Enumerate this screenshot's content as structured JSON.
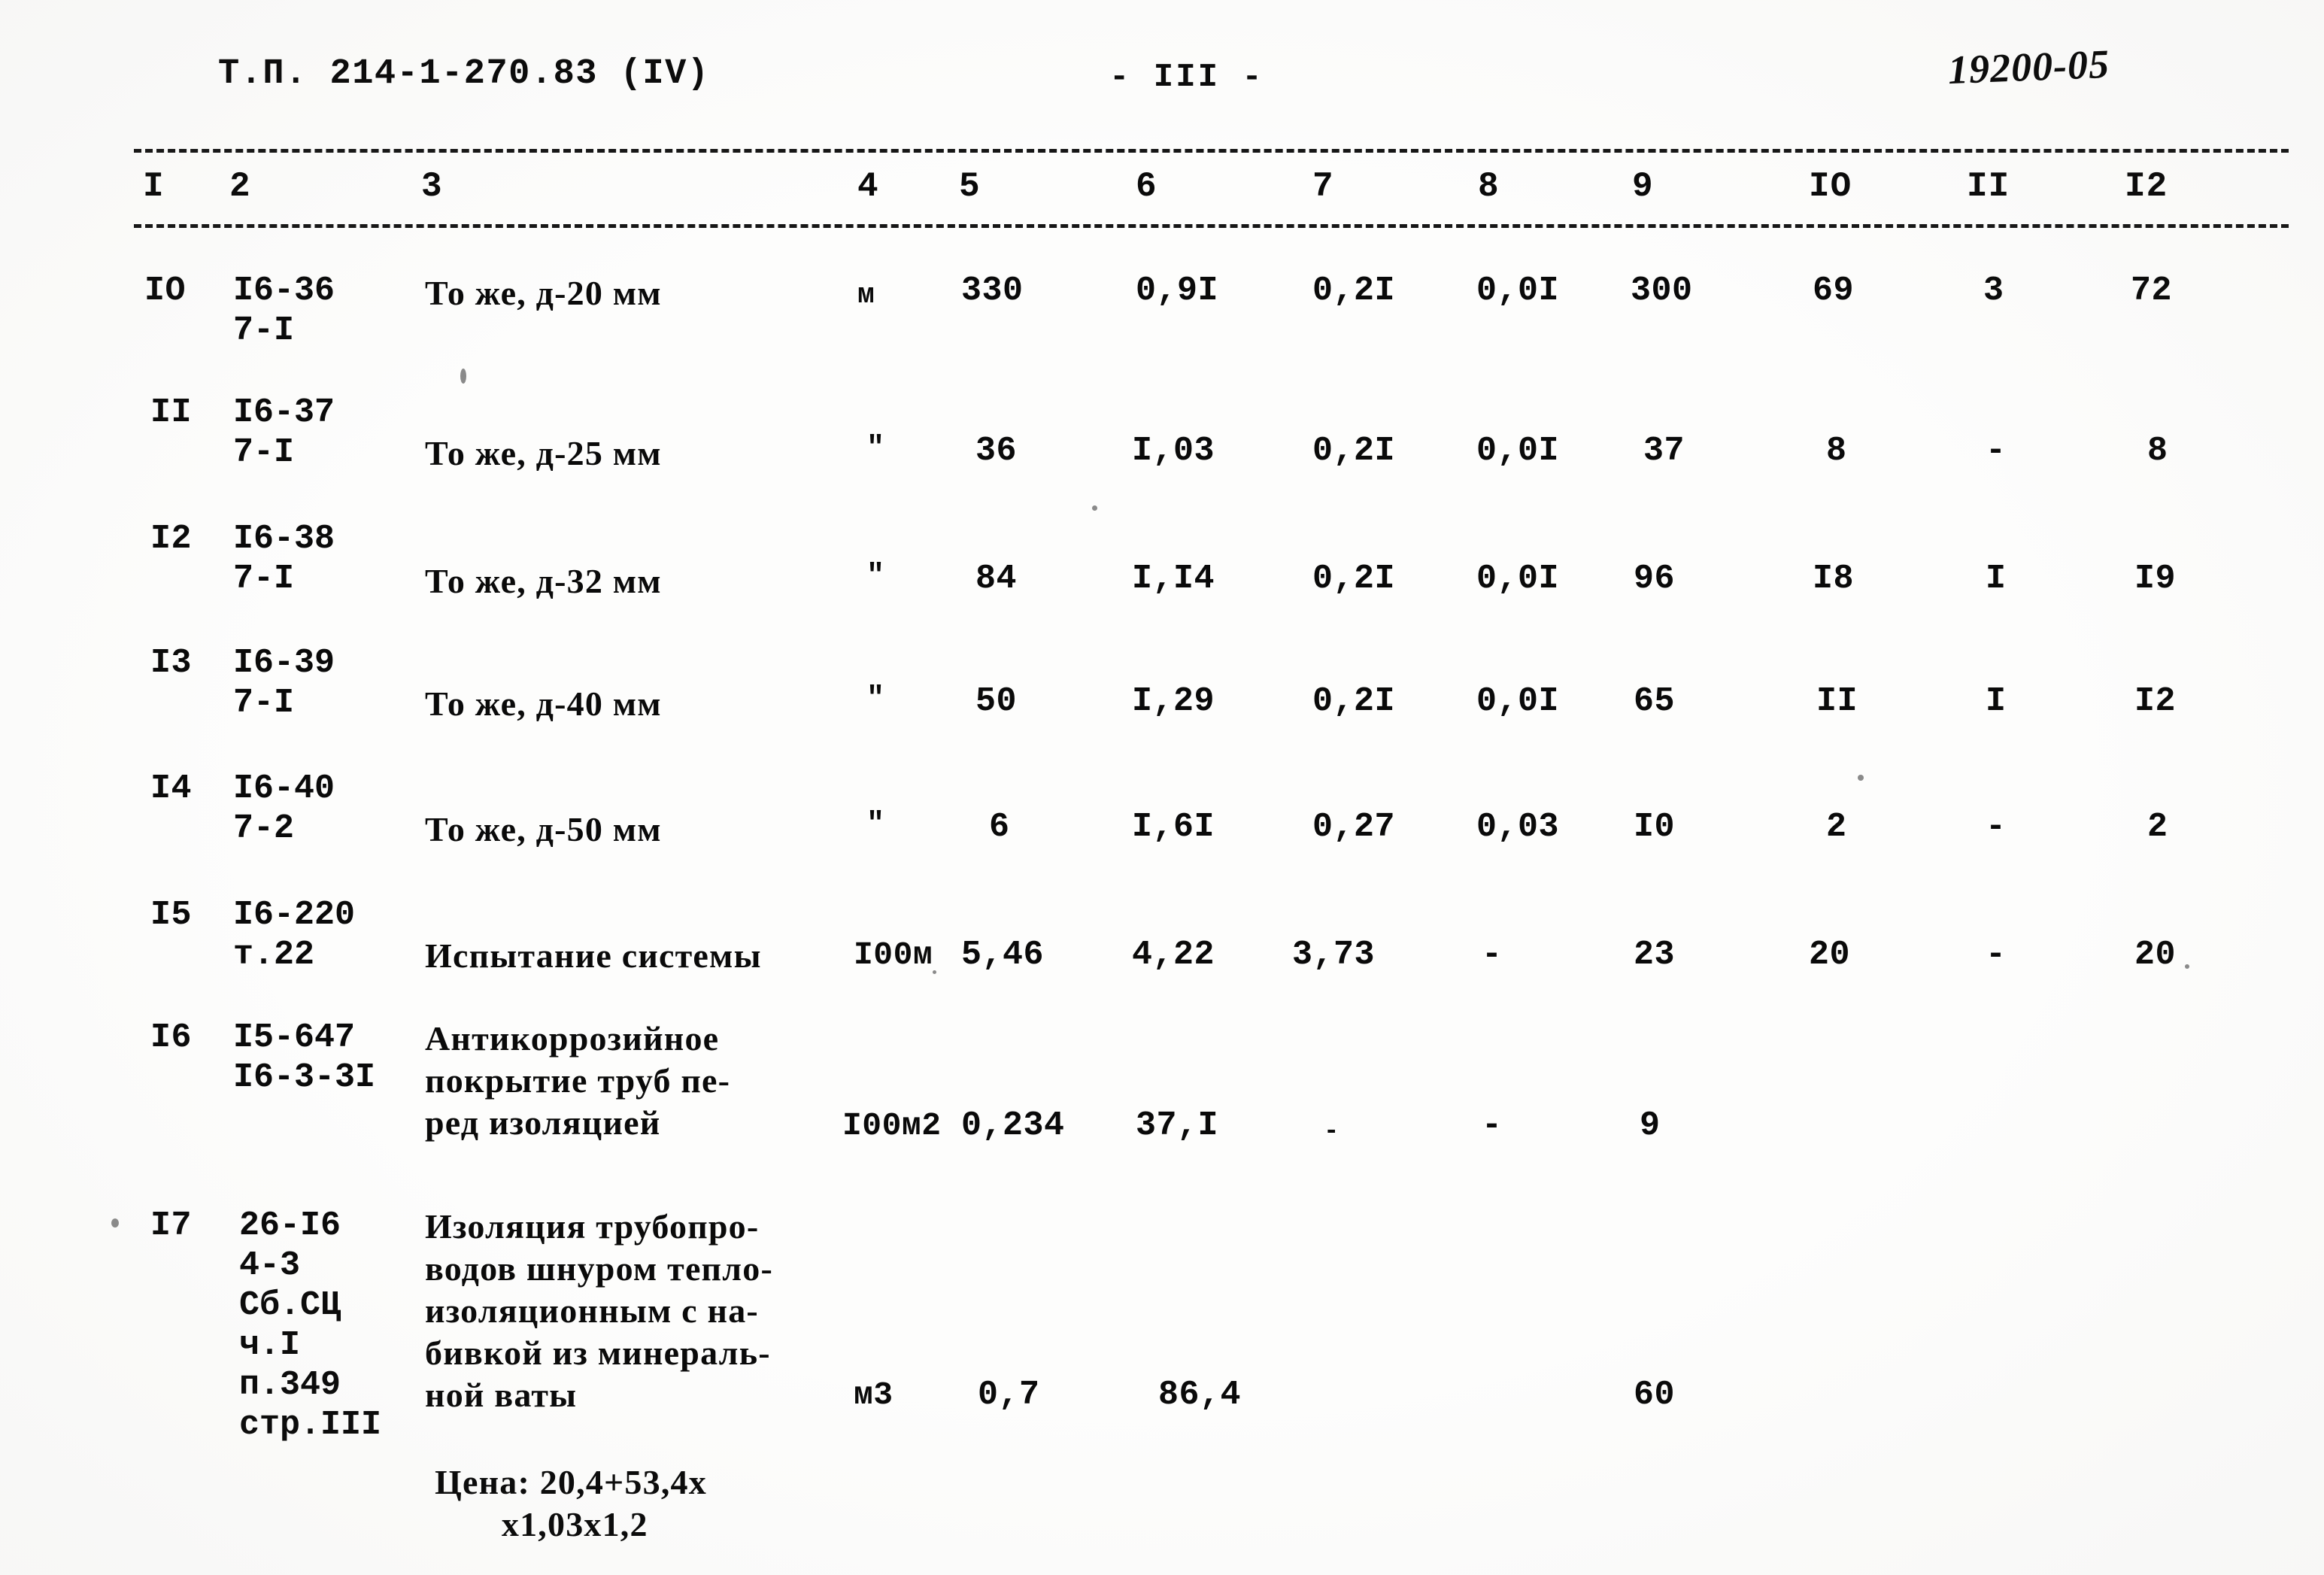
{
  "header": {
    "left": "Т.П. 214-1-270.83 (IV)",
    "center": "- III -",
    "right": "19200-05"
  },
  "table": {
    "column_headers": [
      "I",
      "2",
      "3",
      "4",
      "5",
      "6",
      "7",
      "8",
      "9",
      "IO",
      "II",
      "I2"
    ],
    "rows": [
      {
        "num": "IO",
        "code": "I6-36\n7-I",
        "desc": "То же, д-20 мм",
        "unit": "м",
        "c5": "330",
        "c6": "0,9I",
        "c7": "0,2I",
        "c8": "0,0I",
        "c9": "300",
        "c10": "69",
        "c11": "3",
        "c12": "72"
      },
      {
        "num": "II",
        "code": "I6-37\n7-I",
        "desc": "То же, д-25 мм",
        "unit": "\"",
        "c5": "36",
        "c6": "I,03",
        "c7": "0,2I",
        "c8": "0,0I",
        "c9": "37",
        "c10": "8",
        "c11": "-",
        "c12": "8"
      },
      {
        "num": "I2",
        "code": "I6-38\n7-I",
        "desc": "То же, д-32 мм",
        "unit": "\"",
        "c5": "84",
        "c6": "I,I4",
        "c7": "0,2I",
        "c8": "0,0I",
        "c9": "96",
        "c10": "I8",
        "c11": "I",
        "c12": "I9"
      },
      {
        "num": "I3",
        "code": "I6-39\n7-I",
        "desc": "То же, д-40 мм",
        "unit": "\"",
        "c5": "50",
        "c6": "I,29",
        "c7": "0,2I",
        "c8": "0,0I",
        "c9": "65",
        "c10": "II",
        "c11": "I",
        "c12": "I2"
      },
      {
        "num": "I4",
        "code": "I6-40\n7-2",
        "desc": "То же, д-50 мм",
        "unit": "\"",
        "c5": "6",
        "c6": "I,6I",
        "c7": "0,27",
        "c8": "0,03",
        "c9": "I0",
        "c10": "2",
        "c11": "-",
        "c12": "2"
      },
      {
        "num": "I5",
        "code": "I6-220\nт.22",
        "desc": "Испытание системы",
        "unit": "I00м",
        "c5": "5,46",
        "c6": "4,22",
        "c7": "3,73",
        "c8": "-",
        "c9": "23",
        "c10": "20",
        "c11": "-",
        "c12": "20"
      },
      {
        "num": "I6",
        "code": "I5-647\nI6-3-3I",
        "desc": "Антикоррозийное\nпокрытие труб пе-\nред изоляцией",
        "unit": "I00м2",
        "c5": "0,234",
        "c6": "37,I",
        "c7": "-",
        "c8": "-",
        "c9": "9",
        "c10": "",
        "c11": "",
        "c12": ""
      },
      {
        "num": "I7",
        "code": "26-I6\n4-3\nСб.СЦ\nч.I\nп.349\nстр.III",
        "desc": "Изоляция трубопро-\nводов шнуром тепло-\nизоляционным с на-\nбивкой из минераль-\nной ваты",
        "unit": "м3",
        "c5": "0,7",
        "c6": "86,4",
        "c7": "",
        "c8": "",
        "c9": "60",
        "c10": "",
        "c11": "",
        "c12": ""
      }
    ],
    "footnote": "Цена: 20,4+53,4х\n       х1,03х1,2"
  }
}
